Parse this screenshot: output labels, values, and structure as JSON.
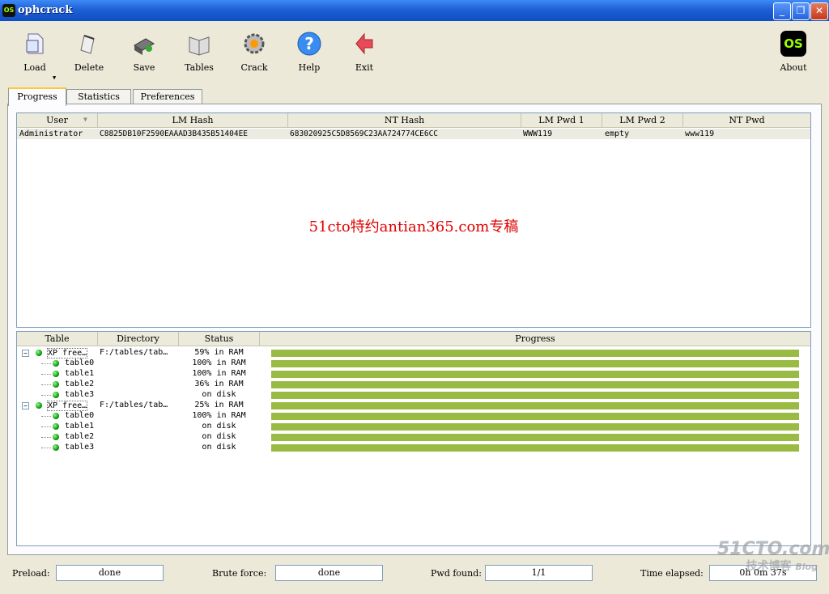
{
  "window": {
    "title": "ophcrack",
    "icon_text": "OS"
  },
  "toolbar": {
    "items": [
      {
        "label": "Load",
        "icon": "load-icon"
      },
      {
        "label": "Delete",
        "icon": "delete-icon"
      },
      {
        "label": "Save",
        "icon": "save-icon"
      },
      {
        "label": "Tables",
        "icon": "tables-icon"
      },
      {
        "label": "Crack",
        "icon": "crack-icon"
      },
      {
        "label": "Help",
        "icon": "help-icon"
      },
      {
        "label": "Exit",
        "icon": "exit-icon"
      }
    ],
    "about": {
      "label": "About",
      "logo_text": "OS"
    }
  },
  "tabs": [
    "Progress",
    "Statistics",
    "Preferences"
  ],
  "hash_table": {
    "columns": [
      "User",
      "LM Hash",
      "NT Hash",
      "LM Pwd 1",
      "LM Pwd 2",
      "NT Pwd"
    ],
    "rows": [
      {
        "user": "Administrator",
        "lm_hash": "C8825DB10F2590EAAAD3B435B51404EE",
        "nt_hash": "683020925C5D8569C23AA724774CE6CC",
        "lm_pwd1": "WWW119",
        "lm_pwd2": "empty",
        "nt_pwd": "www119"
      }
    ],
    "watermark": "51cto特约antian365.com专稿"
  },
  "tables_table": {
    "columns": [
      "Table",
      "Directory",
      "Status",
      "Progress"
    ],
    "rows": [
      {
        "name": "XP free…",
        "dir": "F:/tables/tab…",
        "status": "59% in RAM",
        "progress": 1.0,
        "level": 0
      },
      {
        "name": "table0",
        "dir": "",
        "status": "100% in RAM",
        "progress": 1.0,
        "level": 1
      },
      {
        "name": "table1",
        "dir": "",
        "status": "100% in RAM",
        "progress": 1.0,
        "level": 1
      },
      {
        "name": "table2",
        "dir": "",
        "status": "36% in RAM",
        "progress": 1.0,
        "level": 1
      },
      {
        "name": "table3",
        "dir": "",
        "status": "on disk",
        "progress": 1.0,
        "level": 1
      },
      {
        "name": "XP free…",
        "dir": "F:/tables/tab…",
        "status": "25% in RAM",
        "progress": 1.0,
        "level": 0
      },
      {
        "name": "table0",
        "dir": "",
        "status": "100% in RAM",
        "progress": 1.0,
        "level": 1
      },
      {
        "name": "table1",
        "dir": "",
        "status": "on disk",
        "progress": 1.0,
        "level": 1
      },
      {
        "name": "table2",
        "dir": "",
        "status": "on disk",
        "progress": 1.0,
        "level": 1
      },
      {
        "name": "table3",
        "dir": "",
        "status": "on disk",
        "progress": 1.0,
        "level": 1
      }
    ]
  },
  "statusbar": {
    "preload_label": "Preload:",
    "preload_value": "done",
    "brute_label": "Brute force:",
    "brute_value": "done",
    "pwd_label": "Pwd found:",
    "pwd_value": "1/1",
    "time_label": "Time elapsed:",
    "time_value": "0h 0m 37s"
  },
  "corner_watermark": {
    "line1": "51CTO.com",
    "line2": "技术博客",
    "line3": "Blog"
  },
  "colors": {
    "progress_bar": "#99bb44",
    "title_bar": "#1f5fd6",
    "watermark": "#e00000"
  }
}
